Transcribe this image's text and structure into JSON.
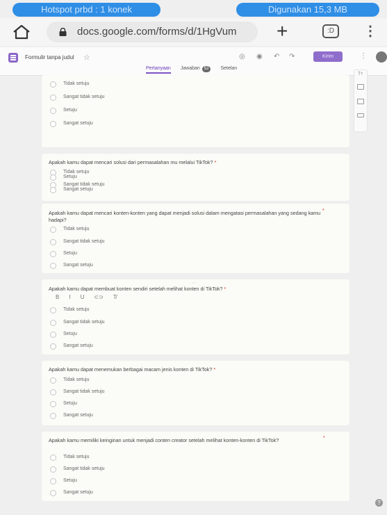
{
  "status_bar": {
    "hotspot": "Hotspot prbd : 1 konek",
    "usage": "Digunakan 15,3 MB",
    "accent": "#2f8ee5"
  },
  "browser": {
    "url": "docs.google.com/forms/d/1HgVum",
    "tabs_count": ":D",
    "icons": [
      "home-icon",
      "lock-icon",
      "new-tab-icon",
      "tabs-icon",
      "menu-icon"
    ]
  },
  "form_header": {
    "title": "Formulir tanpa judul",
    "send_label": "Kirim",
    "tabs": [
      {
        "label": "Pertanyaan",
        "active": true
      },
      {
        "label": "Jawaban",
        "badge": "52",
        "active": false
      },
      {
        "label": "Setelan",
        "active": false
      }
    ],
    "accent": "#673ab7"
  },
  "cards": [
    {
      "question": "",
      "options": [
        "Tidak setuju",
        "Sangat tidak setuju",
        "Setuju",
        "Sangat setuju"
      ]
    },
    {
      "question": "Apakah kamu dapat mencari solusi dari permasalahan mu melalui TikTok?",
      "options": [
        "Tidak setuju",
        "Sangat tidak setuju",
        "Setuju",
        "Sangat setuju"
      ]
    },
    {
      "question": "Apakah kamu dapat mencari konten-konten yang dapat menjadi solusi dalam mengatasi permasalahan yang sedang kamu hadapi?",
      "options": [
        "Tidak setuju",
        "Sangat tidak setuju",
        "Setuju",
        "Sangat setuju"
      ]
    },
    {
      "question": "Apakah kamu dapat membuat konten sendiri setelah melihat konten di TikTok?",
      "format_tools": [
        "B",
        "I",
        "U",
        "⊂⊃",
        "T̸"
      ],
      "options": [
        "Tidak setuju",
        "Sangat tidak setuju",
        "Setuju",
        "Sangat setuju"
      ]
    },
    {
      "question": "Apakah kamu dapat menemukan berbagai macam jenis konten di TikTok?",
      "options": [
        "Tidak setuju",
        "Sangat tidak setuju",
        "Setuju",
        "Sangat setuju"
      ]
    },
    {
      "question": "Apakah kamu memiliki keinginan untuk menjadi conten creator setelah melihat konten-konten di TikTok?",
      "options": [
        "Tidak setuju",
        "Sangat tidak setuju",
        "Setuju",
        "Sangat setuju"
      ]
    }
  ],
  "required_mark": "*",
  "help_label": "?"
}
